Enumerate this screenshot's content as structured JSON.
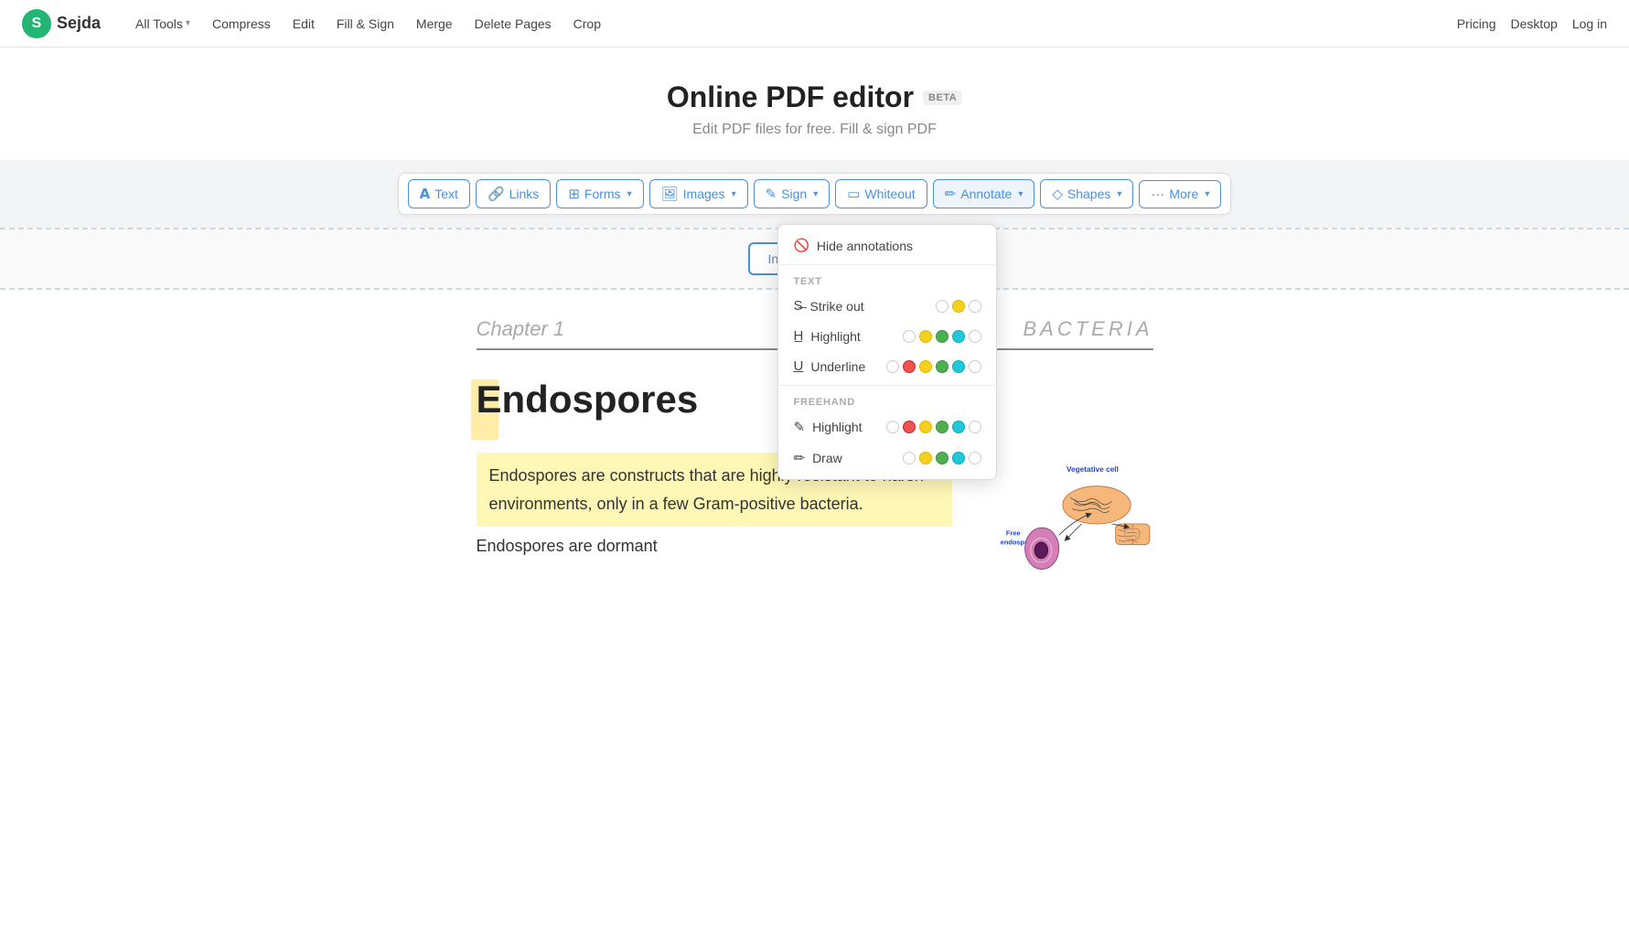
{
  "navbar": {
    "logo_letter": "S",
    "logo_name": "Sejda",
    "links": [
      {
        "label": "All Tools",
        "has_dropdown": true
      },
      {
        "label": "Compress",
        "has_dropdown": false
      },
      {
        "label": "Edit",
        "has_dropdown": false
      },
      {
        "label": "Fill & Sign",
        "has_dropdown": false
      },
      {
        "label": "Merge",
        "has_dropdown": false
      },
      {
        "label": "Delete Pages",
        "has_dropdown": false
      },
      {
        "label": "Crop",
        "has_dropdown": false
      }
    ],
    "right_links": [
      {
        "label": "Pricing"
      },
      {
        "label": "Desktop"
      },
      {
        "label": "Log in"
      }
    ]
  },
  "hero": {
    "title": "Online PDF editor",
    "beta_label": "BETA",
    "subtitle": "Edit PDF files for free. Fill & sign PDF"
  },
  "toolbar": {
    "tools": [
      {
        "label": "Text",
        "icon": "T",
        "has_dropdown": false
      },
      {
        "label": "Links",
        "icon": "🔗",
        "has_dropdown": false
      },
      {
        "label": "Forms",
        "icon": "☐",
        "has_dropdown": true
      },
      {
        "label": "Images",
        "icon": "🖼",
        "has_dropdown": true
      },
      {
        "label": "Sign",
        "icon": "✏",
        "has_dropdown": true
      },
      {
        "label": "Whiteout",
        "icon": "⬜",
        "has_dropdown": false
      },
      {
        "label": "Annotate",
        "icon": "✏",
        "has_dropdown": true,
        "active": true
      },
      {
        "label": "Shapes",
        "icon": "◇",
        "has_dropdown": true
      },
      {
        "label": "More",
        "icon": "···",
        "has_dropdown": true
      }
    ]
  },
  "insert_page_button": "Insert page here",
  "annotate_dropdown": {
    "hide_item": "Hide annotations",
    "text_section": "TEXT",
    "freehand_section": "FREEHAND",
    "text_items": [
      {
        "label": "Strike out",
        "colors": [
          "empty",
          "yellow",
          "empty"
        ]
      },
      {
        "label": "Highlight",
        "colors": [
          "empty",
          "yellow",
          "green",
          "teal",
          "empty"
        ]
      },
      {
        "label": "Underline",
        "colors": [
          "empty",
          "red",
          "yellow",
          "green",
          "teal",
          "empty"
        ]
      }
    ],
    "freehand_items": [
      {
        "label": "Highlight",
        "colors": [
          "empty",
          "red",
          "yellow",
          "green",
          "teal",
          "empty"
        ]
      },
      {
        "label": "Draw",
        "colors": [
          "empty",
          "yellow",
          "green",
          "teal",
          "empty"
        ]
      }
    ]
  },
  "pdf_content": {
    "chapter": "Chapter 1",
    "bacteria": "BACTERIA",
    "heading": "Endospores",
    "paragraph1": "Endospores are constructs that are highly resistant to harsh environments, only in a few Gram-positive bacteria.",
    "paragraph2": "Endospores are dormant"
  }
}
